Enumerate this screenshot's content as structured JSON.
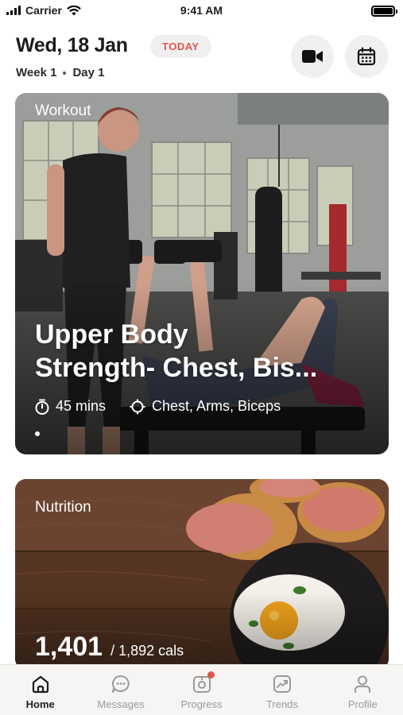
{
  "status_bar": {
    "carrier": "Carrier",
    "time": "9:41 AM"
  },
  "header": {
    "date": "Wed, 18 Jan",
    "today_label": "TODAY",
    "week": "Week 1",
    "day": "Day 1"
  },
  "workout_card": {
    "label": "Workout",
    "title_line1": "Upper Body",
    "title_line2": "Strength- Chest, Bis...",
    "duration": "45 mins",
    "focus": "Chest, Arms, Biceps"
  },
  "nutrition_card": {
    "label": "Nutrition",
    "calories": "1,401",
    "goal": "/ 1,892 cals"
  },
  "tabs": [
    {
      "label": "Home",
      "icon": "home-icon",
      "active": true
    },
    {
      "label": "Messages",
      "icon": "chat-icon",
      "active": false
    },
    {
      "label": "Progress",
      "icon": "camera-icon",
      "active": false
    },
    {
      "label": "Trends",
      "icon": "trend-icon",
      "active": false
    },
    {
      "label": "Profile",
      "icon": "person-icon",
      "active": false
    }
  ],
  "colors": {
    "accent": "#e2574c",
    "text": "#1c1c1e",
    "muted": "#9a9a9a"
  }
}
